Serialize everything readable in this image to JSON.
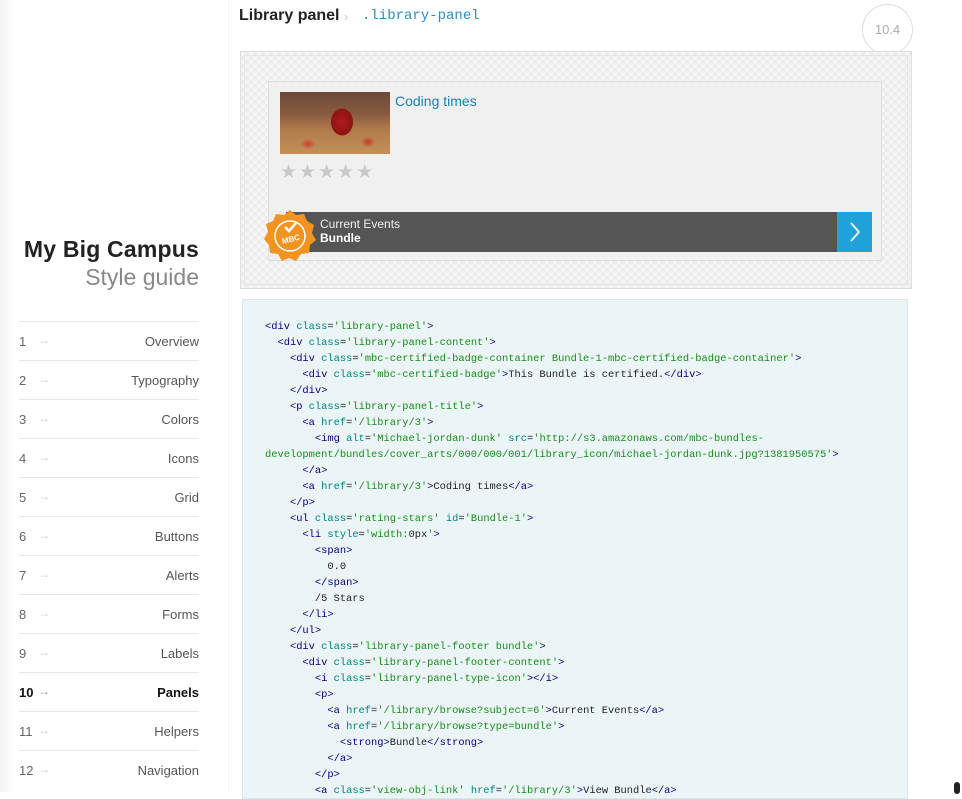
{
  "brand": {
    "title": "My Big Campus",
    "subtitle": "Style guide"
  },
  "nav": [
    {
      "num": "1",
      "label": "Overview",
      "active": false
    },
    {
      "num": "2",
      "label": "Typography",
      "active": false
    },
    {
      "num": "3",
      "label": "Colors",
      "active": false
    },
    {
      "num": "4",
      "label": "Icons",
      "active": false
    },
    {
      "num": "5",
      "label": "Grid",
      "active": false
    },
    {
      "num": "6",
      "label": "Buttons",
      "active": false
    },
    {
      "num": "7",
      "label": "Alerts",
      "active": false
    },
    {
      "num": "8",
      "label": "Forms",
      "active": false
    },
    {
      "num": "9",
      "label": "Labels",
      "active": false
    },
    {
      "num": "10",
      "label": "Panels",
      "active": true
    },
    {
      "num": "11",
      "label": "Helpers",
      "active": false
    },
    {
      "num": "12",
      "label": "Navigation",
      "active": false
    }
  ],
  "nav_arrow": "→",
  "section": {
    "title": "Library panel",
    "separator": "›",
    "css_class": ".library-panel",
    "number": "10.4"
  },
  "panel": {
    "image_alt": "Michael-jordan-dunk",
    "title": "Coding times",
    "rating_stars": 5,
    "footer_line1": "Current Events",
    "footer_line2": "Bundle",
    "badge_text": "MBC",
    "view_link_icon": "chevron-right-icon",
    "colors": {
      "link": "#1a7fb5",
      "footer_bg": "#555555",
      "view_link_bg": "#1ea2d8",
      "badge": "#f39321"
    }
  },
  "code_lines": [
    [
      [
        "t",
        "<div "
      ],
      [
        "a",
        "class"
      ],
      [
        "p",
        "="
      ],
      [
        "s",
        "'library-panel'"
      ],
      [
        "t",
        ">"
      ]
    ],
    [
      [
        "p",
        "  "
      ],
      [
        "t",
        "<div "
      ],
      [
        "a",
        "class"
      ],
      [
        "p",
        "="
      ],
      [
        "s",
        "'library-panel-content'"
      ],
      [
        "t",
        ">"
      ]
    ],
    [
      [
        "p",
        "    "
      ],
      [
        "t",
        "<div "
      ],
      [
        "a",
        "class"
      ],
      [
        "p",
        "="
      ],
      [
        "s",
        "'mbc-certified-badge-container Bundle-1-mbc-certified-badge-container'"
      ],
      [
        "t",
        ">"
      ]
    ],
    [
      [
        "p",
        "      "
      ],
      [
        "t",
        "<div "
      ],
      [
        "a",
        "class"
      ],
      [
        "p",
        "="
      ],
      [
        "s",
        "'mbc-certified-badge'"
      ],
      [
        "t",
        ">"
      ],
      [
        "p",
        "This Bundle is certified."
      ],
      [
        "t",
        "</div>"
      ]
    ],
    [
      [
        "p",
        "    "
      ],
      [
        "t",
        "</div>"
      ]
    ],
    [
      [
        "p",
        "    "
      ],
      [
        "t",
        "<p "
      ],
      [
        "a",
        "class"
      ],
      [
        "p",
        "="
      ],
      [
        "s",
        "'library-panel-title'"
      ],
      [
        "t",
        ">"
      ]
    ],
    [
      [
        "p",
        "      "
      ],
      [
        "t",
        "<a "
      ],
      [
        "a",
        "href"
      ],
      [
        "p",
        "="
      ],
      [
        "s",
        "'/library/3'"
      ],
      [
        "t",
        ">"
      ]
    ],
    [
      [
        "p",
        "        "
      ],
      [
        "t",
        "<img "
      ],
      [
        "a",
        "alt"
      ],
      [
        "p",
        "="
      ],
      [
        "s",
        "'Michael-jordan-dunk'"
      ],
      [
        "p",
        " "
      ],
      [
        "a",
        "src"
      ],
      [
        "p",
        "="
      ],
      [
        "s",
        "'http://s3.amazonaws.com/mbc-bundles-"
      ]
    ],
    [
      [
        "s",
        "development/bundles/cover_arts/000/000/001/library_icon/michael-jordan-dunk.jpg?1381950575'"
      ],
      [
        "t",
        ">"
      ]
    ],
    [
      [
        "p",
        "      "
      ],
      [
        "t",
        "</a>"
      ]
    ],
    [
      [
        "p",
        "      "
      ],
      [
        "t",
        "<a "
      ],
      [
        "a",
        "href"
      ],
      [
        "p",
        "="
      ],
      [
        "s",
        "'/library/3'"
      ],
      [
        "t",
        ">"
      ],
      [
        "p",
        "Coding times"
      ],
      [
        "t",
        "</a>"
      ]
    ],
    [
      [
        "p",
        "    "
      ],
      [
        "t",
        "</p>"
      ]
    ],
    [
      [
        "p",
        "    "
      ],
      [
        "t",
        "<ul "
      ],
      [
        "a",
        "class"
      ],
      [
        "p",
        "="
      ],
      [
        "s",
        "'rating-stars'"
      ],
      [
        "p",
        " "
      ],
      [
        "a",
        "id"
      ],
      [
        "p",
        "="
      ],
      [
        "s",
        "'Bundle-1'"
      ],
      [
        "t",
        ">"
      ]
    ],
    [
      [
        "p",
        "      "
      ],
      [
        "t",
        "<li "
      ],
      [
        "a",
        "style"
      ],
      [
        "p",
        "="
      ],
      [
        "s",
        "'width:"
      ],
      [
        "p",
        "0px"
      ],
      [
        "s",
        "'"
      ],
      [
        "t",
        ">"
      ]
    ],
    [
      [
        "p",
        "        "
      ],
      [
        "t",
        "<span>"
      ]
    ],
    [
      [
        "p",
        "          0.0"
      ]
    ],
    [
      [
        "p",
        "        "
      ],
      [
        "t",
        "</span>"
      ]
    ],
    [
      [
        "p",
        "        /5 Stars"
      ]
    ],
    [
      [
        "p",
        "      "
      ],
      [
        "t",
        "</li>"
      ]
    ],
    [
      [
        "p",
        "    "
      ],
      [
        "t",
        "</ul>"
      ]
    ],
    [
      [
        "p",
        "    "
      ],
      [
        "t",
        "<div "
      ],
      [
        "a",
        "class"
      ],
      [
        "p",
        "="
      ],
      [
        "s",
        "'library-panel-footer bundle'"
      ],
      [
        "t",
        ">"
      ]
    ],
    [
      [
        "p",
        "      "
      ],
      [
        "t",
        "<div "
      ],
      [
        "a",
        "class"
      ],
      [
        "p",
        "="
      ],
      [
        "s",
        "'library-panel-footer-content'"
      ],
      [
        "t",
        ">"
      ]
    ],
    [
      [
        "p",
        "        "
      ],
      [
        "t",
        "<i "
      ],
      [
        "a",
        "class"
      ],
      [
        "p",
        "="
      ],
      [
        "s",
        "'library-panel-type-icon'"
      ],
      [
        "t",
        "></i>"
      ]
    ],
    [
      [
        "p",
        "        "
      ],
      [
        "t",
        "<p>"
      ]
    ],
    [
      [
        "p",
        "          "
      ],
      [
        "t",
        "<a "
      ],
      [
        "a",
        "href"
      ],
      [
        "p",
        "="
      ],
      [
        "s",
        "'/library/browse?subject=6'"
      ],
      [
        "t",
        ">"
      ],
      [
        "p",
        "Current Events"
      ],
      [
        "t",
        "</a>"
      ]
    ],
    [
      [
        "p",
        "          "
      ],
      [
        "t",
        "<a "
      ],
      [
        "a",
        "href"
      ],
      [
        "p",
        "="
      ],
      [
        "s",
        "'/library/browse?type=bundle'"
      ],
      [
        "t",
        ">"
      ]
    ],
    [
      [
        "p",
        "            "
      ],
      [
        "t",
        "<strong>"
      ],
      [
        "p",
        "Bundle"
      ],
      [
        "t",
        "</strong>"
      ]
    ],
    [
      [
        "p",
        "          "
      ],
      [
        "t",
        "</a>"
      ]
    ],
    [
      [
        "p",
        "        "
      ],
      [
        "t",
        "</p>"
      ]
    ],
    [
      [
        "p",
        "        "
      ],
      [
        "t",
        "<a "
      ],
      [
        "a",
        "class"
      ],
      [
        "p",
        "="
      ],
      [
        "s",
        "'view-obj-link'"
      ],
      [
        "p",
        " "
      ],
      [
        "a",
        "href"
      ],
      [
        "p",
        "="
      ],
      [
        "s",
        "'/library/3'"
      ],
      [
        "t",
        ">"
      ],
      [
        "p",
        "View Bundle"
      ],
      [
        "t",
        "</a>"
      ]
    ]
  ]
}
